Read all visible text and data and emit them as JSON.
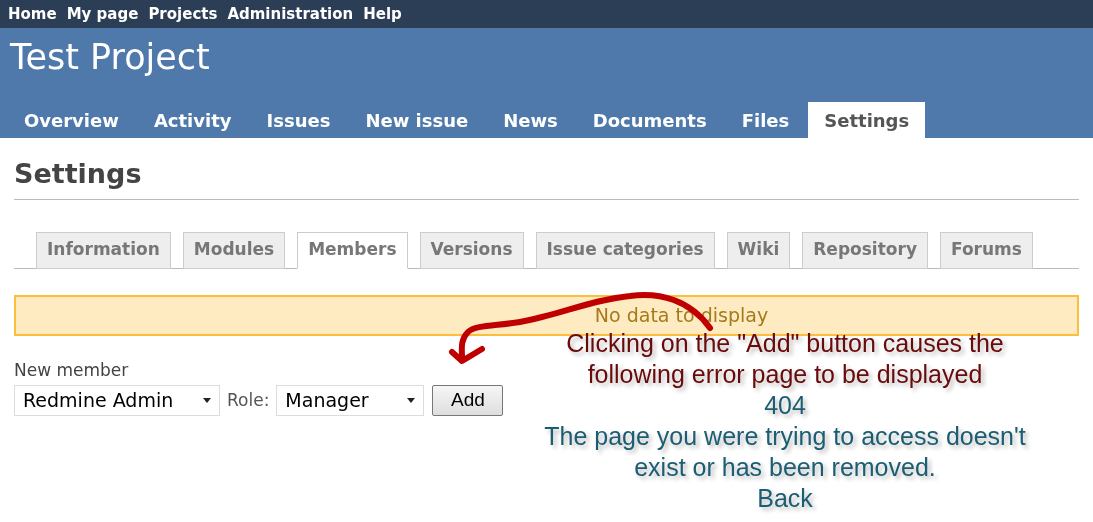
{
  "top_menu": [
    "Home",
    "My page",
    "Projects",
    "Administration",
    "Help"
  ],
  "project": {
    "title": "Test Project"
  },
  "main_tabs": [
    {
      "label": "Overview",
      "selected": false
    },
    {
      "label": "Activity",
      "selected": false
    },
    {
      "label": "Issues",
      "selected": false
    },
    {
      "label": "New issue",
      "selected": false
    },
    {
      "label": "News",
      "selected": false
    },
    {
      "label": "Documents",
      "selected": false
    },
    {
      "label": "Files",
      "selected": false
    },
    {
      "label": "Settings",
      "selected": true
    }
  ],
  "heading": "Settings",
  "settings_tabs": [
    {
      "label": "Information",
      "selected": false
    },
    {
      "label": "Modules",
      "selected": false
    },
    {
      "label": "Members",
      "selected": true
    },
    {
      "label": "Versions",
      "selected": false
    },
    {
      "label": "Issue categories",
      "selected": false
    },
    {
      "label": "Wiki",
      "selected": false
    },
    {
      "label": "Repository",
      "selected": false
    },
    {
      "label": "Forums",
      "selected": false
    }
  ],
  "flash": "No data to display",
  "new_member": {
    "label": "New member",
    "member_value": "Redmine Admin",
    "role_label": "Role:",
    "role_value": "Manager",
    "button": "Add"
  },
  "annotation": {
    "note": "Clicking on the \"Add\" button causes the following error page to be displayed",
    "error_code": "404",
    "error_message": "The page you were trying to access doesn't exist or has been removed.",
    "back": "Back"
  }
}
